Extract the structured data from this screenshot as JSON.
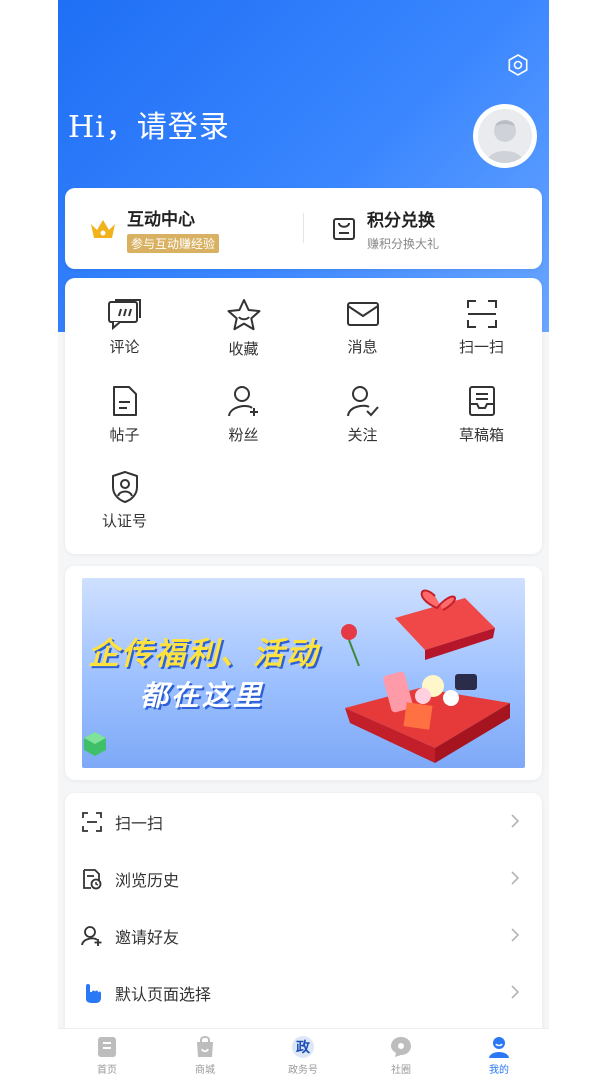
{
  "header": {
    "greeting": "Hi，请登录"
  },
  "interaction": {
    "left": {
      "title": "互动中心",
      "subtitle": "参与互动赚经验"
    },
    "right": {
      "title": "积分兑换",
      "subtitle": "赚积分换大礼"
    }
  },
  "grid": [
    {
      "label": "评论",
      "icon": "comment-icon"
    },
    {
      "label": "收藏",
      "icon": "star-icon"
    },
    {
      "label": "消息",
      "icon": "mail-icon"
    },
    {
      "label": "扫一扫",
      "icon": "scan-icon"
    },
    {
      "label": "帖子",
      "icon": "document-icon"
    },
    {
      "label": "粉丝",
      "icon": "user-add-icon"
    },
    {
      "label": "关注",
      "icon": "user-check-icon"
    },
    {
      "label": "草稿箱",
      "icon": "draft-box-icon"
    },
    {
      "label": "认证号",
      "icon": "shield-user-icon"
    }
  ],
  "banner": {
    "line1": "企传福利、活动",
    "line2": "都在这里"
  },
  "list": [
    {
      "label": "扫一扫",
      "icon": "scan-icon"
    },
    {
      "label": "浏览历史",
      "icon": "history-icon"
    },
    {
      "label": "邀请好友",
      "icon": "invite-icon"
    },
    {
      "label": "默认页面选择",
      "icon": "hand-pointer-icon"
    }
  ],
  "tabs": [
    {
      "label": "首页",
      "icon": "home-icon"
    },
    {
      "label": "商城",
      "icon": "shop-bag-icon"
    },
    {
      "label": "政务号",
      "icon": "gov-icon",
      "glyph": "政"
    },
    {
      "label": "社圈",
      "icon": "community-icon"
    },
    {
      "label": "我的",
      "icon": "profile-icon",
      "active": true
    }
  ],
  "colors": {
    "accent": "#2a78f5",
    "gold": "#d9b162",
    "hero_start": "#1f6ff5"
  }
}
